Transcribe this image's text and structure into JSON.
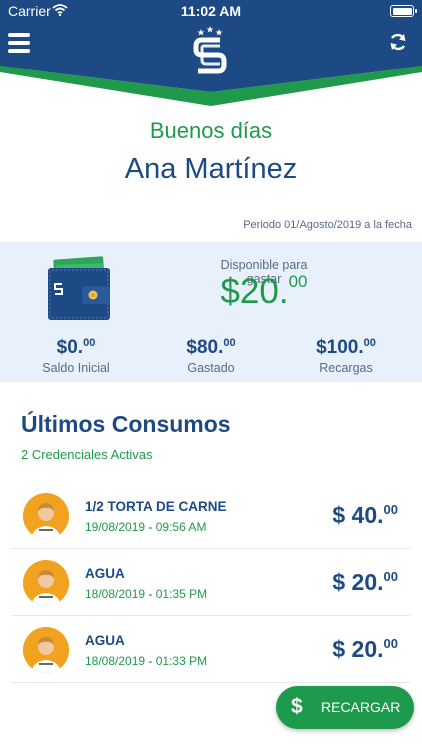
{
  "status_bar": {
    "carrier": "Carrier",
    "time": "11:02 AM",
    "battery_level": 1.0
  },
  "header": {
    "logo_text": "CS",
    "menu_icon": "hamburger-menu-icon",
    "refresh_icon": "refresh-icon"
  },
  "greeting": "Buenos días",
  "user_name": "Ana Martínez",
  "period": "Periodo 01/Agosto/2019 a la fecha",
  "summary": {
    "available_label": "Disponible para gastar",
    "available_amount": "$20.",
    "available_cents": "00",
    "stats": [
      {
        "value": "$0.",
        "cents": "00",
        "label": "Saldo Inicial"
      },
      {
        "value": "$80.",
        "cents": "00",
        "label": "Gastado"
      },
      {
        "value": "$100.",
        "cents": "00",
        "label": "Recargas"
      }
    ]
  },
  "section": {
    "title": "Últimos Consumos",
    "subtitle": "2 Credenciales Activas"
  },
  "transactions": [
    {
      "item": "1/2 TORTA DE CARNE",
      "date": "19/08/2019",
      "time": "09:56 AM",
      "amount": "$ 40.",
      "cents": "00"
    },
    {
      "item": "AGUA",
      "date": "18/08/2019",
      "time": "01:35 PM",
      "amount": "$ 20.",
      "cents": "00"
    },
    {
      "item": "AGUA",
      "date": "18/08/2019",
      "time": "01:33 PM",
      "amount": "$ 20.",
      "cents": "00"
    }
  ],
  "recargar_button": {
    "icon": "$",
    "label": "RECARGAR"
  },
  "colors": {
    "navy": "#1d4a85",
    "green": "#1f9a4a",
    "light_bg": "#e8f1fb",
    "avatar_bg": "#f1a21f"
  }
}
